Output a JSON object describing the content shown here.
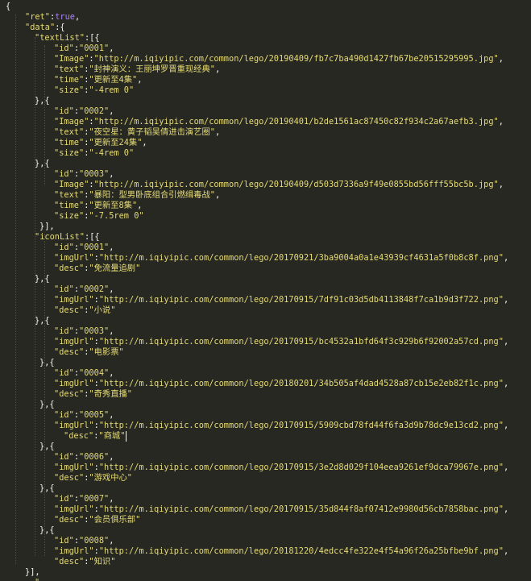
{
  "editor": {
    "lines": [
      [
        {
          "t": "{",
          "c": "p"
        }
      ],
      [
        {
          "t": "\"ret\"",
          "c": "s"
        },
        {
          "t": ":",
          "c": "p"
        },
        {
          "t": "true",
          "c": "kw"
        },
        {
          "t": ",",
          "c": "p"
        }
      ],
      [
        {
          "t": "\"data\"",
          "c": "s"
        },
        {
          "t": ":{",
          "c": "p"
        }
      ],
      [
        {
          "t": "\"textList\"",
          "c": "s"
        },
        {
          "t": ":[{",
          "c": "p"
        }
      ],
      [
        {
          "t": "\"id\"",
          "c": "s"
        },
        {
          "t": ":",
          "c": "p"
        },
        {
          "t": "\"0001\"",
          "c": "s"
        },
        {
          "t": ",",
          "c": "p"
        }
      ],
      [
        {
          "t": "\"Image\"",
          "c": "s"
        },
        {
          "t": ":",
          "c": "p"
        },
        {
          "t": "\"http://m.iqiyipic.com/common/lego/20190409/fb7c7ba490d1427fb67be20515295995.jpg\"",
          "c": "s"
        },
        {
          "t": ",",
          "c": "p"
        }
      ],
      [
        {
          "t": "\"text\"",
          "c": "s"
        },
        {
          "t": ":",
          "c": "p"
        },
        {
          "t": "\"封神演义：王丽坤罗晋重现经典\"",
          "c": "s"
        },
        {
          "t": ",",
          "c": "p"
        }
      ],
      [
        {
          "t": "\"time\"",
          "c": "s"
        },
        {
          "t": ":",
          "c": "p"
        },
        {
          "t": "\"更新至4集\"",
          "c": "s"
        },
        {
          "t": ",",
          "c": "p"
        }
      ],
      [
        {
          "t": "\"size\"",
          "c": "s"
        },
        {
          "t": ":",
          "c": "p"
        },
        {
          "t": "\"-4rem 0\"",
          "c": "s"
        }
      ],
      [
        {
          "t": "},{",
          "c": "p"
        }
      ],
      [
        {
          "t": "\"id\"",
          "c": "s"
        },
        {
          "t": ":",
          "c": "p"
        },
        {
          "t": "\"0002\"",
          "c": "s"
        },
        {
          "t": ",",
          "c": "p"
        }
      ],
      [
        {
          "t": "\"Image\"",
          "c": "s"
        },
        {
          "t": ":",
          "c": "p"
        },
        {
          "t": "\"http://m.iqiyipic.com/common/lego/20190401/b2de1561ac87450c82f934c2a67aefb3.jpg\"",
          "c": "s"
        },
        {
          "t": ",",
          "c": "p"
        }
      ],
      [
        {
          "t": "\"text\"",
          "c": "s"
        },
        {
          "t": ":",
          "c": "p"
        },
        {
          "t": "\"夜空星：黄子韬吴倩进击演艺圈\"",
          "c": "s"
        },
        {
          "t": ",",
          "c": "p"
        }
      ],
      [
        {
          "t": "\"time\"",
          "c": "s"
        },
        {
          "t": ":",
          "c": "p"
        },
        {
          "t": "\"更新至24集\"",
          "c": "s"
        },
        {
          "t": ",",
          "c": "p"
        }
      ],
      [
        {
          "t": "\"size\"",
          "c": "s"
        },
        {
          "t": ":",
          "c": "p"
        },
        {
          "t": "\"-4rem 0\"",
          "c": "s"
        }
      ],
      [
        {
          "t": "},{",
          "c": "p"
        }
      ],
      [
        {
          "t": "\"id\"",
          "c": "s"
        },
        {
          "t": ":",
          "c": "p"
        },
        {
          "t": "\"0003\"",
          "c": "s"
        },
        {
          "t": ",",
          "c": "p"
        }
      ],
      [
        {
          "t": "\"Image\"",
          "c": "s"
        },
        {
          "t": ":",
          "c": "p"
        },
        {
          "t": "\"http://m.iqiyipic.com/common/lego/20190409/d503d7336a9f49e0855bd56fff55bc5b.jpg\"",
          "c": "s"
        },
        {
          "t": ",",
          "c": "p"
        }
      ],
      [
        {
          "t": "\"text\"",
          "c": "s"
        },
        {
          "t": ":",
          "c": "p"
        },
        {
          "t": "\"暴阳：型男卧底组合引燃缉毒战\"",
          "c": "s"
        },
        {
          "t": ",",
          "c": "p"
        }
      ],
      [
        {
          "t": "\"time\"",
          "c": "s"
        },
        {
          "t": ":",
          "c": "p"
        },
        {
          "t": "\"更新至8集\"",
          "c": "s"
        },
        {
          "t": ",",
          "c": "p"
        }
      ],
      [
        {
          "t": "\"size\"",
          "c": "s"
        },
        {
          "t": ":",
          "c": "p"
        },
        {
          "t": "\"-7.5rem 0\"",
          "c": "s"
        }
      ],
      [
        {
          "t": "}],",
          "c": "p"
        }
      ],
      [
        {
          "t": "\"iconList\"",
          "c": "s"
        },
        {
          "t": ":[{",
          "c": "p"
        }
      ],
      [
        {
          "t": "\"id\"",
          "c": "s"
        },
        {
          "t": ":",
          "c": "p"
        },
        {
          "t": "\"0001\"",
          "c": "s"
        },
        {
          "t": ",",
          "c": "p"
        }
      ],
      [
        {
          "t": "\"imgUrl\"",
          "c": "s"
        },
        {
          "t": ":",
          "c": "p"
        },
        {
          "t": "\"http://m.iqiyipic.com/common/lego/20170921/3ba9004a0a1e43939cf4631a5f0b8c8f.png\"",
          "c": "s"
        },
        {
          "t": ",",
          "c": "p"
        }
      ],
      [
        {
          "t": "\"desc\"",
          "c": "s"
        },
        {
          "t": ":",
          "c": "p"
        },
        {
          "t": "\"免流量追剧\"",
          "c": "s"
        }
      ],
      [
        {
          "t": "},{",
          "c": "p"
        }
      ],
      [
        {
          "t": "\"id\"",
          "c": "s"
        },
        {
          "t": ":",
          "c": "p"
        },
        {
          "t": "\"0002\"",
          "c": "s"
        },
        {
          "t": ",",
          "c": "p"
        }
      ],
      [
        {
          "t": "\"imgUrl\"",
          "c": "s"
        },
        {
          "t": ":",
          "c": "p"
        },
        {
          "t": "\"http://m.iqiyipic.com/common/lego/20170915/7df91c03d5db4113848f7ca1b9d3f722.png\"",
          "c": "s"
        },
        {
          "t": ",",
          "c": "p"
        }
      ],
      [
        {
          "t": "\"desc\"",
          "c": "s"
        },
        {
          "t": ":",
          "c": "p"
        },
        {
          "t": "\"小说\"",
          "c": "s"
        }
      ],
      [
        {
          "t": "},{",
          "c": "p"
        }
      ],
      [
        {
          "t": "\"id\"",
          "c": "s"
        },
        {
          "t": ":",
          "c": "p"
        },
        {
          "t": "\"0003\"",
          "c": "s"
        },
        {
          "t": ",",
          "c": "p"
        }
      ],
      [
        {
          "t": "\"imgUrl\"",
          "c": "s"
        },
        {
          "t": ":",
          "c": "p"
        },
        {
          "t": "\"http://m.iqiyipic.com/common/lego/20170915/bc4532a1bfd64f3c929b6f92002a57cd.png\"",
          "c": "s"
        },
        {
          "t": ",",
          "c": "p"
        }
      ],
      [
        {
          "t": "\"desc\"",
          "c": "s"
        },
        {
          "t": ":",
          "c": "p"
        },
        {
          "t": "\"电影票\"",
          "c": "s"
        }
      ],
      [
        {
          "t": "},{",
          "c": "p"
        }
      ],
      [
        {
          "t": "\"id\"",
          "c": "s"
        },
        {
          "t": ":",
          "c": "p"
        },
        {
          "t": "\"0004\"",
          "c": "s"
        },
        {
          "t": ",",
          "c": "p"
        }
      ],
      [
        {
          "t": "\"imgUrl\"",
          "c": "s"
        },
        {
          "t": ":",
          "c": "p"
        },
        {
          "t": "\"http://m.iqiyipic.com/common/lego/20180201/34b505af4dad4528a87cb15e2eb82f1c.png\"",
          "c": "s"
        },
        {
          "t": ",",
          "c": "p"
        }
      ],
      [
        {
          "t": "\"desc\"",
          "c": "s"
        },
        {
          "t": ":",
          "c": "p"
        },
        {
          "t": "\"奇秀直播\"",
          "c": "s"
        }
      ],
      [
        {
          "t": "},{",
          "c": "p"
        }
      ],
      [
        {
          "t": "\"id\"",
          "c": "s"
        },
        {
          "t": ":",
          "c": "p"
        },
        {
          "t": "\"0005\"",
          "c": "s"
        },
        {
          "t": ",",
          "c": "p"
        }
      ],
      [
        {
          "t": "\"imgUrl\"",
          "c": "s"
        },
        {
          "t": ":",
          "c": "p"
        },
        {
          "t": "\"http://m.iqiyipic.com/common/lego/20170915/5909cbd78fd44f6fa3d9b78dc9e13cd2.png\"",
          "c": "s"
        },
        {
          "t": ",",
          "c": "p"
        }
      ],
      [
        {
          "t": "\"desc\"",
          "c": "s"
        },
        {
          "t": ":",
          "c": "p"
        },
        {
          "t": "\"商城\"",
          "c": "s"
        }
      ],
      [
        {
          "t": "},{",
          "c": "p"
        }
      ],
      [
        {
          "t": "\"id\"",
          "c": "s"
        },
        {
          "t": ":",
          "c": "p"
        },
        {
          "t": "\"0006\"",
          "c": "s"
        },
        {
          "t": ",",
          "c": "p"
        }
      ],
      [
        {
          "t": "\"imgUrl\"",
          "c": "s"
        },
        {
          "t": ":",
          "c": "p"
        },
        {
          "t": "\"http://m.iqiyipic.com/common/lego/20170915/3e2d8d029f104eea9261ef9dca79967e.png\"",
          "c": "s"
        },
        {
          "t": ",",
          "c": "p"
        }
      ],
      [
        {
          "t": "\"desc\"",
          "c": "s"
        },
        {
          "t": ":",
          "c": "p"
        },
        {
          "t": "\"游戏中心\"",
          "c": "s"
        }
      ],
      [
        {
          "t": "},{",
          "c": "p"
        }
      ],
      [
        {
          "t": "\"id\"",
          "c": "s"
        },
        {
          "t": ":",
          "c": "p"
        },
        {
          "t": "\"0007\"",
          "c": "s"
        },
        {
          "t": ",",
          "c": "p"
        }
      ],
      [
        {
          "t": "\"imgUrl\"",
          "c": "s"
        },
        {
          "t": ":",
          "c": "p"
        },
        {
          "t": "\"http://m.iqiyipic.com/common/lego/20170915/35d844f8af07412e9980d56cb7858bac.png\"",
          "c": "s"
        },
        {
          "t": ",",
          "c": "p"
        }
      ],
      [
        {
          "t": "\"desc\"",
          "c": "s"
        },
        {
          "t": ":",
          "c": "p"
        },
        {
          "t": "\"会员俱乐部\"",
          "c": "s"
        }
      ],
      [
        {
          "t": "},{",
          "c": "p"
        }
      ],
      [
        {
          "t": "\"id\"",
          "c": "s"
        },
        {
          "t": ":",
          "c": "p"
        },
        {
          "t": "\"0008\"",
          "c": "s"
        },
        {
          "t": ",",
          "c": "p"
        }
      ],
      [
        {
          "t": "\"imgUrl\"",
          "c": "s"
        },
        {
          "t": ":",
          "c": "p"
        },
        {
          "t": "\"http://m.iqiyipic.com/common/lego/20181220/4edcc4fe322e4f54a96f26a25bfbe9bf.png\"",
          "c": "s"
        },
        {
          "t": ",",
          "c": "p"
        }
      ],
      [
        {
          "t": "\"desc\"",
          "c": "s"
        },
        {
          "t": ":",
          "c": "p"
        },
        {
          "t": "\"知识\"",
          "c": "s"
        }
      ],
      [
        {
          "t": "}],",
          "c": "p"
        }
      ],
      [
        {
          "t": "\"",
          "c": "s"
        }
      ]
    ]
  },
  "colors": {
    "background": "#272822",
    "string": "#e6db74",
    "punctuation": "#f8f8f2",
    "keyword": "#ae81ff"
  }
}
